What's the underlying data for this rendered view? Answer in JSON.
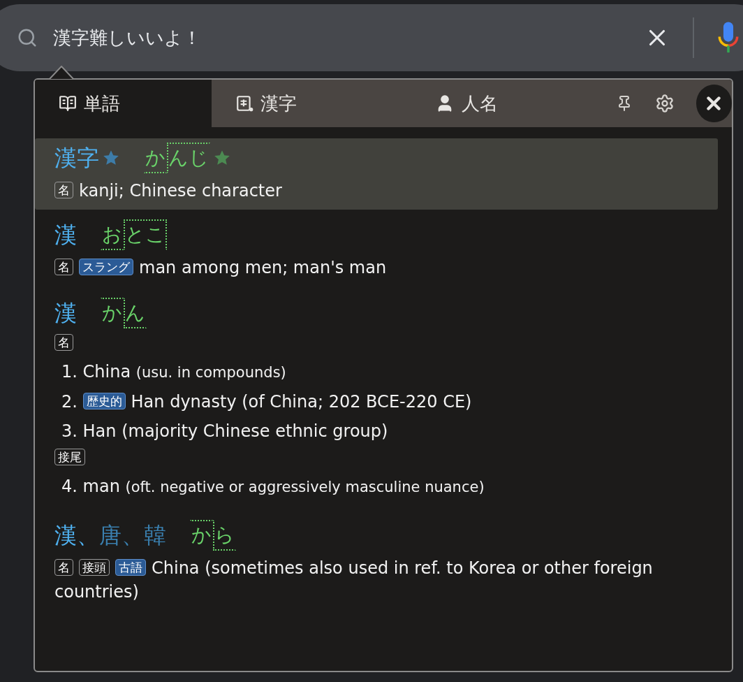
{
  "search": {
    "value": "漢字難しいいよ！"
  },
  "tabs": [
    {
      "label": "単語",
      "selected": true
    },
    {
      "label": "漢字",
      "selected": false
    },
    {
      "label": "人名",
      "selected": false
    }
  ],
  "entries": [
    {
      "kind": "simple",
      "selected": true,
      "headwords": [
        {
          "text": "漢字",
          "primary": true,
          "starred": true
        }
      ],
      "reading": {
        "starred": true,
        "drop_end": false,
        "moras": [
          {
            "text": "か",
            "high": false
          },
          {
            "text": "んじ",
            "high": true
          }
        ]
      },
      "tags": [
        {
          "text": "名",
          "kind": "pos"
        }
      ],
      "gloss": "kanji; Chinese character"
    },
    {
      "kind": "simple",
      "selected": false,
      "headwords": [
        {
          "text": "漢",
          "primary": true
        }
      ],
      "reading": {
        "starred": false,
        "drop_end": true,
        "moras": [
          {
            "text": "お",
            "high": false
          },
          {
            "text": "とこ",
            "high": true
          }
        ]
      },
      "tags": [
        {
          "text": "名",
          "kind": "pos"
        },
        {
          "text": "スラング",
          "kind": "misc"
        }
      ],
      "gloss": "man among men; man's man"
    },
    {
      "kind": "numbered",
      "selected": false,
      "headwords": [
        {
          "text": "漢",
          "primary": true
        }
      ],
      "reading": {
        "starred": false,
        "drop_end": false,
        "moras": [
          {
            "text": "か",
            "high": true
          },
          {
            "text": "ん",
            "high": false
          }
        ]
      },
      "groups": [
        {
          "tags": [
            {
              "text": "名",
              "kind": "pos"
            }
          ],
          "senses": [
            {
              "number": "1.",
              "gloss": "China",
              "note": "(usu. in compounds)"
            },
            {
              "number": "2.",
              "tags": [
                {
                  "text": "歴史的",
                  "kind": "misc"
                }
              ],
              "gloss": "Han dynasty (of China; 202 BCE-220 CE)"
            },
            {
              "number": "3.",
              "gloss": "Han (majority Chinese ethnic group)"
            }
          ]
        },
        {
          "tags": [
            {
              "text": "接尾",
              "kind": "pos"
            }
          ],
          "senses": [
            {
              "number": "4.",
              "gloss": "man",
              "note": "(oft. negative or aggressively masculine nuance)"
            }
          ]
        }
      ]
    },
    {
      "kind": "simple",
      "selected": false,
      "headwords": [
        {
          "text": "漢、",
          "primary": true
        },
        {
          "text": "唐、",
          "primary": false
        },
        {
          "text": "韓",
          "primary": false
        }
      ],
      "reading": {
        "starred": false,
        "drop_end": false,
        "moras": [
          {
            "text": "か",
            "high": true
          },
          {
            "text": "ら",
            "high": false
          }
        ]
      },
      "tags": [
        {
          "text": "名",
          "kind": "pos"
        },
        {
          "text": "接頭",
          "kind": "pos"
        },
        {
          "text": "古語",
          "kind": "misc"
        }
      ],
      "gloss": "China (sometimes also used in ref. to Korea or other foreign countries)"
    }
  ]
}
